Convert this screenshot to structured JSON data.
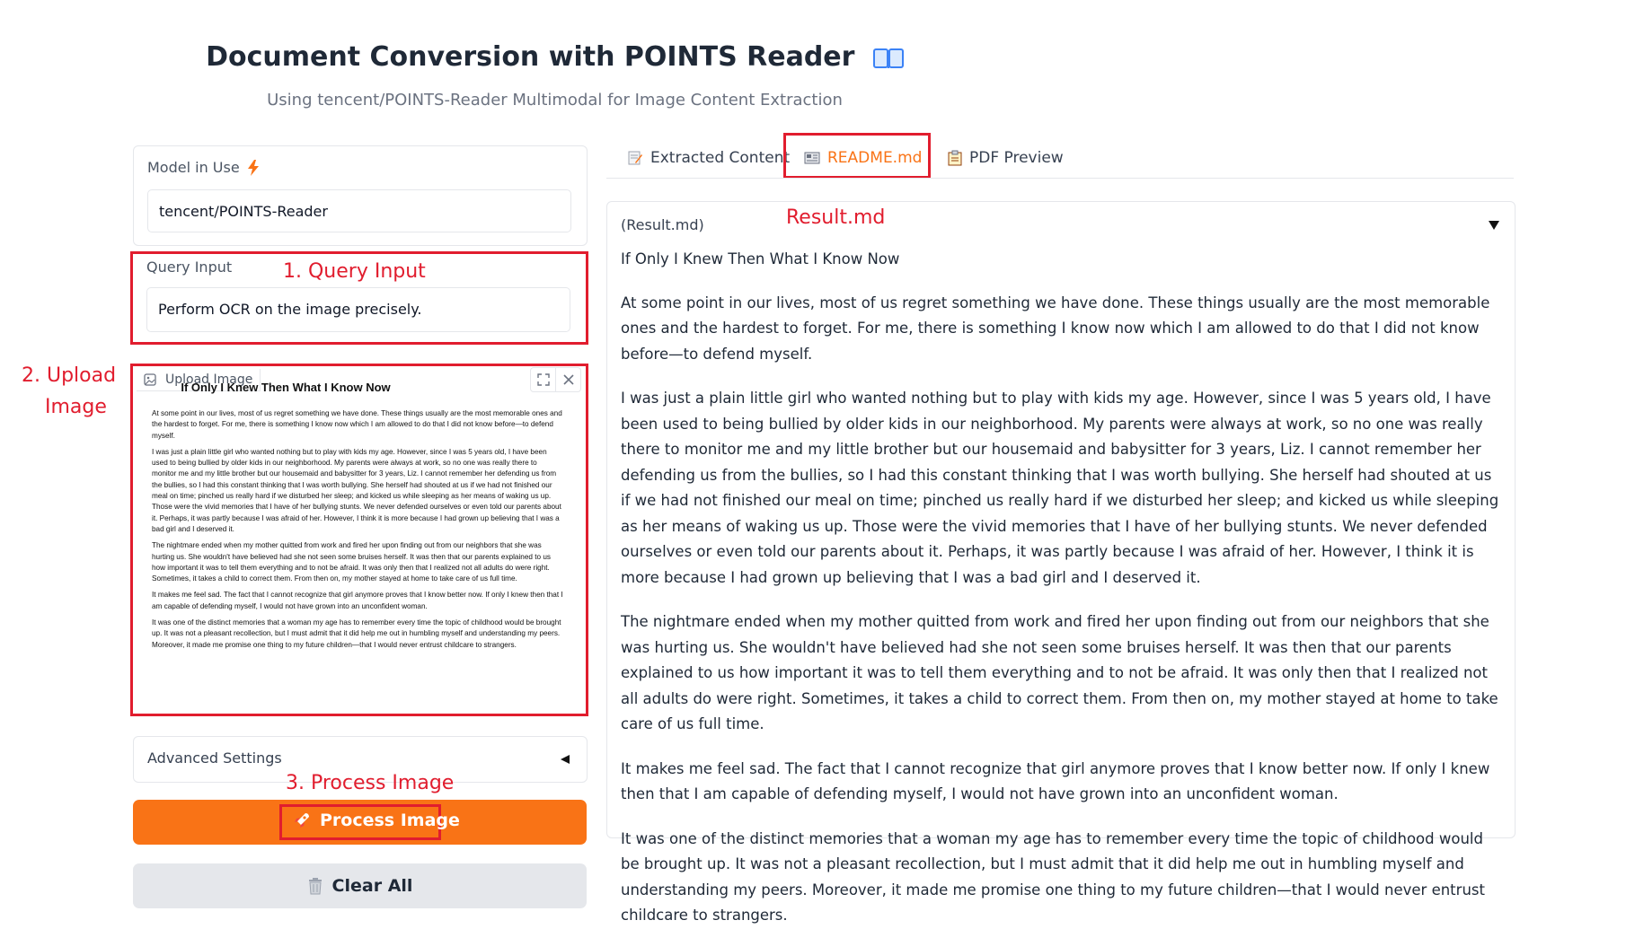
{
  "header": {
    "title": "Document Conversion with POINTS Reader",
    "title_icon": "open-book-icon",
    "subtitle": "Using tencent/POINTS-Reader Multimodal for Image Content Extraction"
  },
  "model": {
    "label": "Model in Use",
    "label_icon": "lightning-icon",
    "value": "tencent/POINTS-Reader"
  },
  "query": {
    "label": "Query Input",
    "value": "Perform OCR on the image precisely."
  },
  "upload": {
    "label": "Upload Image",
    "label_icon": "image-icon",
    "preview": {
      "title": "If Only I Knew Then What I Know Now",
      "paragraphs": [
        "At some point in our lives, most of us regret something we have done. These things usually are the most memorable ones and the hardest to forget. For me, there is something I know now which I am allowed to do that I did not know before—to defend myself.",
        "I was just a plain little girl who wanted nothing but to play with kids my age. However, since I was 5 years old, I have been used to being bullied by older kids in our neighborhood. My parents were always at work, so no one was really there to monitor me and my little brother but our housemaid and babysitter for 3 years, Liz. I cannot remember her defending us from the bullies, so I had this constant thinking that I was worth bullying. She herself had shouted at us if we had not finished our meal on time; pinched us really hard if we disturbed her sleep; and kicked us while sleeping as her means of waking us up. Those were the vivid memories that I have of her bullying stunts. We never defended ourselves or even told our parents about it. Perhaps, it was partly because I was afraid of her. However, I think it is more because I had grown up believing that I was a bad girl and I deserved it.",
        "The nightmare ended when my mother quitted from work and fired her upon finding out from our neighbors that she was hurting us. She wouldn't have believed had she not seen some bruises herself. It was then that our parents explained to us how important it was to tell them everything and to not be afraid. It was only then that I realized not all adults do were right. Sometimes, it takes a child to correct them. From then on, my mother stayed at home to take care of us full time.",
        "It makes me feel sad. The fact that I cannot recognize that girl anymore proves that I know better now. If only I knew then that I am capable of defending myself, I would not have grown into an unconfident woman.",
        "It was one of the distinct memories that a woman my age has to remember every time the topic of childhood would be brought up. It was not a pleasant recollection, but I must admit that it did help me out in humbling myself and understanding my peers. Moreover, it made me promise one thing to my future children—that I would never entrust childcare to strangers."
      ]
    }
  },
  "advanced": {
    "label": "Advanced Settings"
  },
  "buttons": {
    "process": "Process Image",
    "process_icon": "rocket-icon",
    "clear": "Clear All",
    "clear_icon": "trash-icon"
  },
  "annotations": {
    "query": "1. Query Input",
    "upload_line1": "2. Upload",
    "upload_line2": "Image",
    "process": "3. Process Image",
    "result": "Result.md"
  },
  "tabs": [
    {
      "label": "Extracted Content",
      "icon": "memo-pencil-icon",
      "active": false
    },
    {
      "label": "README.md",
      "icon": "newspaper-icon",
      "active": true
    },
    {
      "label": "PDF Preview",
      "icon": "clipboard-icon",
      "active": false
    }
  ],
  "result": {
    "label": "(Result.md)",
    "title": "If Only I Knew Then What I Know Now",
    "paragraphs": [
      "At some point in our lives, most of us regret something we have done. These things usually are the most memorable ones and the hardest to forget. For me, there is something I know now which I am allowed to do that I did not know before—to defend myself.",
      "I was just a plain little girl who wanted nothing but to play with kids my age. However, since I was 5 years old, I have been used to being bullied by older kids in our neighborhood. My parents were always at work, so no one was really there to monitor me and my little brother but our housemaid and babysitter for 3 years, Liz. I cannot remember her defending us from the bullies, so I had this constant thinking that I was worth bullying. She herself had shouted at us if we had not finished our meal on time; pinched us really hard if we disturbed her sleep; and kicked us while sleeping as her means of waking us up. Those were the vivid memories that I have of her bullying stunts. We never defended ourselves or even told our parents about it. Perhaps, it was partly because I was afraid of her. However, I think it is more because I had grown up believing that I was a bad girl and I deserved it.",
      "The nightmare ended when my mother quitted from work and fired her upon finding out from our neighbors that she was hurting us. She wouldn't have believed had she not seen some bruises herself. It was then that our parents explained to us how important it was to tell them everything and to not be afraid. It was only then that I realized not all adults do were right. Sometimes, it takes a child to correct them. From then on, my mother stayed at home to take care of us full time.",
      "It makes me feel sad. The fact that I cannot recognize that girl anymore proves that I know better now. If only I knew then that I am capable of defending myself, I would not have grown into an unconfident woman.",
      "It was one of the distinct memories that a woman my age has to remember every time the topic of childhood would be brought up. It was not a pleasant recollection, but I must admit that it did help me out in humbling myself and understanding my peers. Moreover, it made me promise one thing to my future children—that I would never entrust childcare to strangers."
    ]
  },
  "colors": {
    "accent": "#f97316",
    "annotation_red": "#e11d2e",
    "clear_button": "#e5e7eb"
  }
}
